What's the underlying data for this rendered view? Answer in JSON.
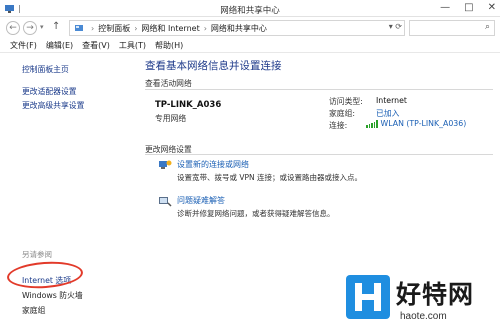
{
  "window": {
    "title": "网络和共享中心"
  },
  "address": {
    "crumbs": [
      "控制面板",
      "网络和 Internet",
      "网络和共享中心"
    ]
  },
  "menu": [
    "文件(F)",
    "编辑(E)",
    "查看(V)",
    "工具(T)",
    "帮助(H)"
  ],
  "sidebar": {
    "items": [
      "控制面板主页",
      "更改适配器设置",
      "更改高级共享设置"
    ],
    "see_also_heading": "另请参阅",
    "see_also": [
      "Internet 选项",
      "Windows 防火墙",
      "家庭组"
    ]
  },
  "main": {
    "heading": "查看基本网络信息并设置连接",
    "active_section": "查看活动网络",
    "network": {
      "name": "TP-LINK_A036",
      "type": "专用网络",
      "access_type_label": "访问类型:",
      "access_type_value": "Internet",
      "homegroup_label": "家庭组:",
      "homegroup_value": "已加入",
      "connection_label": "连接:",
      "connection_value": "WLAN (TP-LINK_A036)"
    },
    "change_section": "更改网络设置",
    "items": [
      {
        "title": "设置新的连接或网络",
        "desc": "设置宽带、拨号或 VPN 连接；或设置路由器或接入点。",
        "icon": "network-setup-icon"
      },
      {
        "title": "问题疑难解答",
        "desc": "诊断并修复网络问题，或者获得疑难解答信息。",
        "icon": "troubleshoot-icon"
      }
    ]
  },
  "watermark": {
    "brand": "好特网",
    "url": "haote.com"
  },
  "colors": {
    "link": "#1a5fb4",
    "heading": "#1e3a8a",
    "highlight": "#e23a2a",
    "signal": "#2aa12a",
    "brand": "#1f8ee0"
  }
}
